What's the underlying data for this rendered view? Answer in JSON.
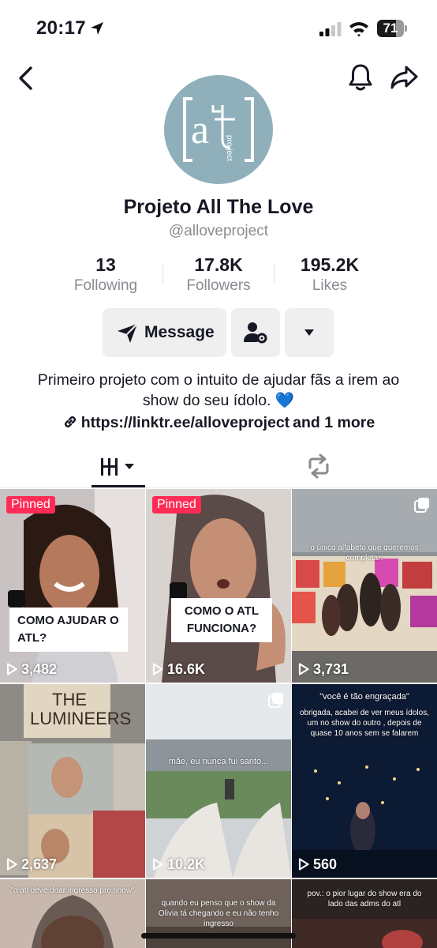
{
  "status_bar": {
    "time": "20:17",
    "battery": "71",
    "battery_level": 0.71
  },
  "profile": {
    "display_name": "Projeto All The Love",
    "username": "@alloveproject",
    "avatar_icon": "atl-project-logo",
    "avatar_color": "#8fb0ba",
    "avatar_text": {
      "main": "a",
      "sub": "pro ject"
    }
  },
  "stats": [
    {
      "value": "13",
      "label": "Following"
    },
    {
      "value": "17.8K",
      "label": "Followers"
    },
    {
      "value": "195.2K",
      "label": "Likes"
    }
  ],
  "actions": {
    "message": "Message"
  },
  "bio": {
    "text": "Primeiro projeto com o intuito de ajudar fãs a irem ao show do seu ídolo.",
    "emoji": "💙",
    "link": "https://linktr.ee/alloveproject",
    "link_more": "and 1 more"
  },
  "tabs": [
    {
      "name": "videos",
      "icon": "grid-icon",
      "active": true
    },
    {
      "name": "reposts",
      "icon": "repost-icon",
      "active": false
    }
  ],
  "videos": [
    {
      "views": "3,482",
      "pinned": "Pinned",
      "caption": "COMO AJUDAR O ATL?"
    },
    {
      "views": "16.6K",
      "pinned": "Pinned",
      "caption": "COMO O ATL FUNCIONA?"
    },
    {
      "views": "3,731",
      "overlay": "o único alfabeto que queremos completar:"
    },
    {
      "views": "2,637",
      "overlay": "THE LUMINEERS"
    },
    {
      "views": "10.2K",
      "overlay": "mãe, eu nunca fui santo..."
    },
    {
      "views": "560",
      "overlay_title": "\"você é tão engraçada\"",
      "overlay": "obrigada, acabei de ver meus ídolos, um no show do outro , depois de quase 10 anos sem se falarem"
    },
    {
      "overlay": "\"o atl deve doar ingresso pro show\""
    },
    {
      "overlay": "quando eu penso que o show da Olivia tá chegando e eu não tenho ingresso"
    },
    {
      "overlay": "pov.: o pior lugar do show era do lado das adms do atl"
    }
  ],
  "colors": {
    "accent": "#fe2c55",
    "text": "#161823",
    "muted": "#8a8b91",
    "button_bg": "#efeff0"
  }
}
